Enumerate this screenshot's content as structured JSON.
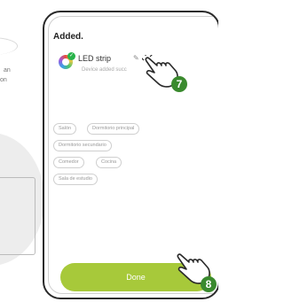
{
  "side": {
    "text_a": "an",
    "text_b": "on"
  },
  "screen": {
    "title": "Added.",
    "device": {
      "name": "LED strip",
      "status": "Device added succ",
      "icon": "rgb-bulb-icon"
    },
    "rooms": [
      "Salón",
      "Dormitorio principal",
      "Dormitorio secundario",
      "Comedor",
      "Cocina",
      "Sala de estudio"
    ],
    "done_label": "Done"
  },
  "steps": {
    "edit_step": "7",
    "done_step": "8"
  },
  "colors": {
    "accent": "#a7c93a",
    "step_badge": "#3a8a2e",
    "check": "#28b34a"
  }
}
